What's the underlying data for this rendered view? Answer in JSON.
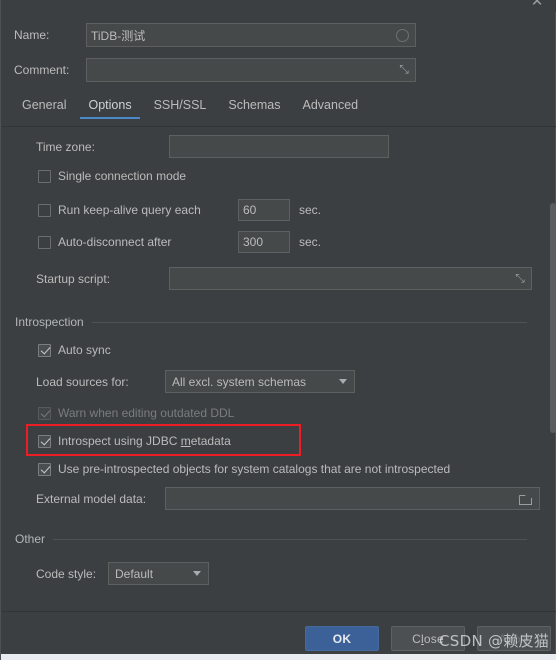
{
  "titlebar": {
    "close_icon": "close-icon",
    "close_glyph": "✕"
  },
  "header": {
    "name_label": "Name:",
    "name_value": "TiDB-测试",
    "comment_label": "Comment:",
    "comment_value": "",
    "expand_glyph": "⤡"
  },
  "tabs": [
    {
      "label": "General",
      "active": false
    },
    {
      "label": "Options",
      "active": true
    },
    {
      "label": "SSH/SSL",
      "active": false
    },
    {
      "label": "Schemas",
      "active": false
    },
    {
      "label": "Advanced",
      "active": false
    }
  ],
  "options": {
    "time_zone_label": "Time zone:",
    "time_zone_value": "",
    "single_connection_label": "Single connection mode",
    "single_connection_checked": false,
    "keepalive_label": "Run keep-alive query each",
    "keepalive_checked": false,
    "keepalive_value": "60",
    "keepalive_unit": "sec.",
    "autodisconnect_label": "Auto-disconnect after",
    "autodisconnect_checked": false,
    "autodisconnect_value": "300",
    "autodisconnect_unit": "sec.",
    "startup_script_label": "Startup script:",
    "startup_script_value": ""
  },
  "introspection": {
    "group_title": "Introspection",
    "auto_sync_label": "Auto sync",
    "auto_sync_checked": true,
    "load_sources_label": "Load sources for:",
    "load_sources_value": "All excl. system schemas",
    "warn_outdated_label": "Warn when editing outdated DDL",
    "warn_outdated_checked": true,
    "jdbc_label": "Introspect using JDBC metadata",
    "jdbc_label_pre": "Introspect using JDBC ",
    "jdbc_label_mnemonic": "m",
    "jdbc_label_post": "etadata",
    "jdbc_checked": true,
    "preintrospected_label": "Use pre-introspected objects for system catalogs that are not introspected",
    "preintrospected_checked": true,
    "external_model_label": "External model data:",
    "external_model_value": ""
  },
  "other": {
    "group_title": "Other",
    "code_style_label": "Code style:",
    "code_style_value": "Default"
  },
  "footer": {
    "ok_label": "OK",
    "close_pre": "C",
    "close_mnemonic": "l",
    "close_post": "ose",
    "apply_pre": "A",
    "apply_mnemonic": "p",
    "apply_post": "ply"
  },
  "watermark": {
    "text": "CSDN @赖皮猫"
  },
  "colors": {
    "background": "#3c3f41",
    "field_bg": "#45494a",
    "accent_tab": "#4a88c7",
    "primary_button": "#3c6199",
    "annotation_red": "#ee1c25",
    "text": "#bbbbbb",
    "text_disabled": "#7a7d80"
  }
}
